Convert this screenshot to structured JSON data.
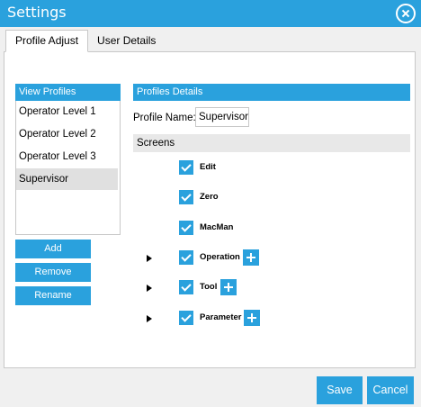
{
  "window": {
    "title": "Settings",
    "accent": "#2aa1dd"
  },
  "tabs": [
    {
      "label": "Profile Adjust",
      "active": true
    },
    {
      "label": "User Details",
      "active": false
    }
  ],
  "profiles": {
    "header": "View Profiles",
    "items": [
      "Operator Level 1",
      "Operator Level 2",
      "Operator Level 3",
      "Supervisor"
    ],
    "selected": "Supervisor"
  },
  "profile_actions": {
    "add": "Add",
    "remove": "Remove",
    "rename": "Rename"
  },
  "details": {
    "header": "Profiles Details",
    "name_label": "Profile Name:",
    "name_value": "Supervisor",
    "screens_label": "Screens",
    "screens": [
      {
        "label": "Edit",
        "checked": true,
        "expandable": false
      },
      {
        "label": "Zero",
        "checked": true,
        "expandable": false
      },
      {
        "label": "MacMan",
        "checked": true,
        "expandable": false
      },
      {
        "label": "Operation",
        "checked": true,
        "expandable": true
      },
      {
        "label": "Tool",
        "checked": true,
        "expandable": true
      },
      {
        "label": "Parameter",
        "checked": true,
        "expandable": true
      }
    ]
  },
  "footer": {
    "save": "Save",
    "cancel": "Cancel"
  }
}
